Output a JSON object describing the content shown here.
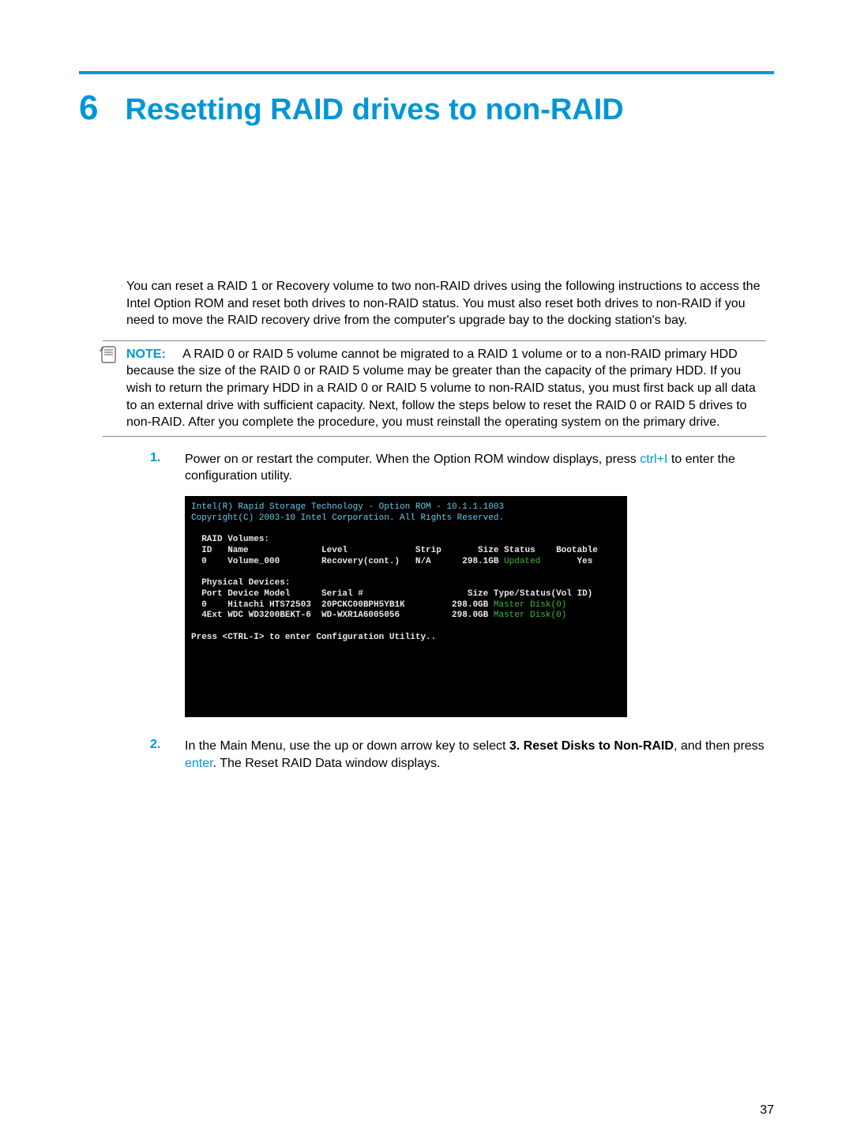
{
  "chapter": {
    "number": "6",
    "title": "Resetting RAID drives to non-RAID"
  },
  "intro": "You can reset a RAID 1 or Recovery volume to two non-RAID drives using the following instructions to access the Intel Option ROM and reset both drives to non-RAID status. You must also reset both drives to non-RAID if you need to move the RAID recovery drive from the computer's upgrade bay to the docking station's bay.",
  "note": {
    "label": "NOTE:",
    "text": "A RAID 0 or RAID 5 volume cannot be migrated to a RAID 1 volume or to a non-RAID primary HDD because the size of the RAID 0 or RAID 5 volume may be greater than the capacity of the primary HDD. If you wish to return the primary HDD in a RAID 0 or RAID 5 volume to non-RAID status, you must first back up all data to an external drive with sufficient capacity. Next, follow the steps below to reset the RAID 0 or RAID 5 drives to non-RAID. After you complete the procedure, you must reinstall the operating system on the primary drive."
  },
  "steps": [
    {
      "num": "1.",
      "pre": "Power on or restart the computer. When the Option ROM window displays, press ",
      "key": "ctrl+I",
      "post": " to enter the configuration utility."
    },
    {
      "num": "2.",
      "pre": "In the Main Menu, use the up or down arrow key to select ",
      "bold": "3. Reset Disks to Non-RAID",
      "mid": ", and then press ",
      "key": "enter",
      "post": ". The Reset RAID Data window displays."
    }
  ],
  "screenshot": {
    "line1": "Intel(R) Rapid Storage Technology - Option ROM - 10.1.1.1003",
    "line2": "Copyright(C) 2003-10 Intel Corporation. All Rights Reserved.",
    "raid_header": "  RAID Volumes:",
    "raid_cols": "  ID   Name              Level             Strip       Size Status    Bootable",
    "raid_row_a": "  0    Volume_000        Recovery(cont.)   N/A      298.1GB",
    "raid_row_status": " Updated",
    "raid_row_boot": "       Yes",
    "phys_header": "  Physical Devices:",
    "phys_cols": "  Port Device Model      Serial #                    Size Type/Status(Vol ID)",
    "phys_row1a": "  0    Hitachi HTS72503  20PCKC00BPH5YB1K         298.0GB",
    "phys_row1g": " Master Disk(0)",
    "phys_row2a": "  4Ext WDC WD3200BEKT-6  WD-WXR1A6005056          298.0GB",
    "phys_row2g": " Master Disk(0)",
    "prompt": "Press <CTRL-I> to enter Configuration Utility.."
  },
  "page_number": "37"
}
